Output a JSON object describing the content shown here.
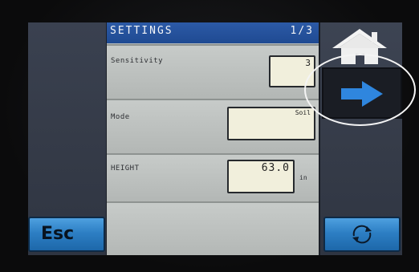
{
  "header": {
    "title": "SETTINGS",
    "page": "1/3"
  },
  "rows": [
    {
      "label": "Sensitivity",
      "value": "3"
    },
    {
      "label": "Mode",
      "value": "Soil"
    },
    {
      "label": "HEIGHT",
      "value": "63.0",
      "unit": "in"
    }
  ],
  "buttons": {
    "esc_label": "Esc"
  },
  "icons": {
    "home": "home-icon",
    "next": "arrow-right-icon",
    "refresh": "refresh-icon"
  },
  "colors": {
    "title_bar": "#1f4a92",
    "button_blue": "#2d7fc4",
    "arrow_blue": "#2f86de",
    "field_bg": "#f1efdc"
  }
}
